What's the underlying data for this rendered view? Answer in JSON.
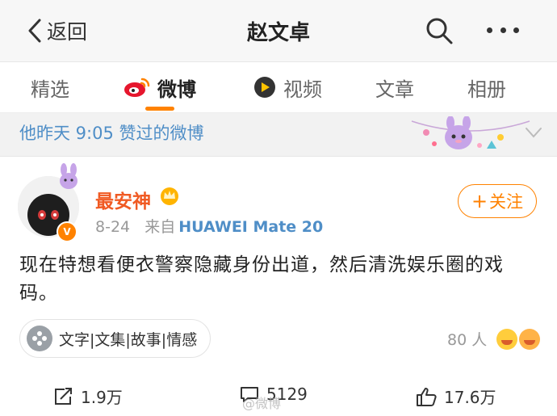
{
  "header": {
    "back_label": "返回",
    "title": "赵文卓"
  },
  "tabs": [
    {
      "label": "精选"
    },
    {
      "label": "微博"
    },
    {
      "label": "视频"
    },
    {
      "label": "文章"
    },
    {
      "label": "相册"
    }
  ],
  "section": {
    "text": "他昨天 9:05 赞过的微博"
  },
  "post": {
    "username": "最安神",
    "verified_badge": "V",
    "date": "8-24",
    "from_label": "来自",
    "source": "HUAWEI Mate 20",
    "follow_label": "关注",
    "follow_plus": "+",
    "content": "现在特想看便衣警察隐藏身份出道，然后清洗娱乐圈的戏码。",
    "topic": "文字|文集|故事|情感",
    "reactors": "80 人",
    "reposts": "1.9万",
    "comments": "5129",
    "likes": "17.6万",
    "watermark": "@微博"
  },
  "colors": {
    "accent": "#ff8200",
    "link": "#4f8ec7",
    "username": "#f05a23"
  }
}
